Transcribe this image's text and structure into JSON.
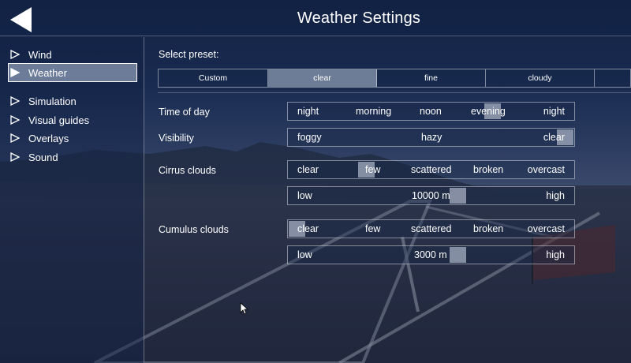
{
  "header": {
    "title": "Weather Settings",
    "back_icon": "back-arrow-icon"
  },
  "sidebar": {
    "items": [
      {
        "label": "Wind",
        "active": false
      },
      {
        "label": "Weather",
        "active": true
      },
      {
        "label": "Simulation",
        "active": false
      },
      {
        "label": "Visual guides",
        "active": false
      },
      {
        "label": "Overlays",
        "active": false
      },
      {
        "label": "Sound",
        "active": false
      }
    ]
  },
  "preset": {
    "label": "Select preset:",
    "options": [
      "Custom",
      "clear",
      "fine",
      "cloudy"
    ],
    "selected": "clear"
  },
  "settings": {
    "time_of_day": {
      "label": "Time of day",
      "stops": [
        "night",
        "morning",
        "noon",
        "evening",
        "night"
      ],
      "position": 0.73
    },
    "visibility": {
      "label": "Visibility",
      "stops": [
        "foggy",
        "hazy",
        "clear"
      ],
      "position": 1.0
    },
    "cirrus": {
      "label": "Cirrus clouds",
      "coverage": {
        "stops": [
          "clear",
          "few",
          "scattered",
          "broken",
          "overcast"
        ],
        "position": 0.26
      },
      "altitude": {
        "low": "low",
        "value": "10000 m",
        "high": "high",
        "position": 0.6
      }
    },
    "cumulus": {
      "label": "Cumulus clouds",
      "coverage": {
        "stops": [
          "clear",
          "few",
          "scattered",
          "broken",
          "overcast"
        ],
        "position": 0.0
      },
      "altitude": {
        "low": "low",
        "value": "3000 m",
        "high": "high",
        "position": 0.6
      }
    }
  },
  "colors": {
    "selected_fill": "#6d7d98",
    "thumb": "#969fb3",
    "border": "#ffffff"
  }
}
